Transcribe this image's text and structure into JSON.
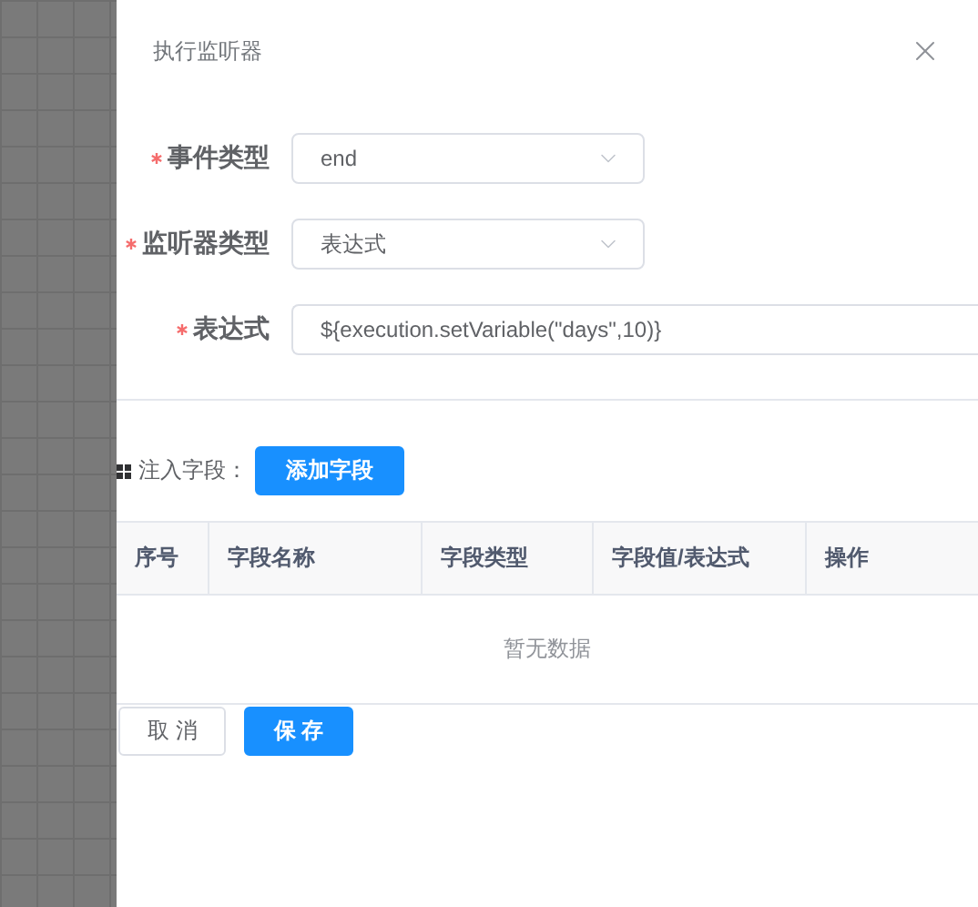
{
  "drawer": {
    "title": "执行监听器"
  },
  "form": [
    {
      "label": "事件类型",
      "required": true,
      "kind": "select",
      "value": "end"
    },
    {
      "label": "监听器类型",
      "required": true,
      "kind": "select",
      "value": "表达式"
    },
    {
      "label": "表达式",
      "required": true,
      "kind": "input",
      "value": "${execution.setVariable(\"days\",10)}"
    }
  ],
  "inject": {
    "label": "注入字段：",
    "add_button": "添加字段"
  },
  "table": {
    "columns": [
      "序号",
      "字段名称",
      "字段类型",
      "字段值/表达式",
      "操作"
    ],
    "empty_text": "暂无数据"
  },
  "buttons": [
    {
      "label": "取 消",
      "kind": "default"
    },
    {
      "label": "保 存",
      "kind": "primary"
    }
  ]
}
